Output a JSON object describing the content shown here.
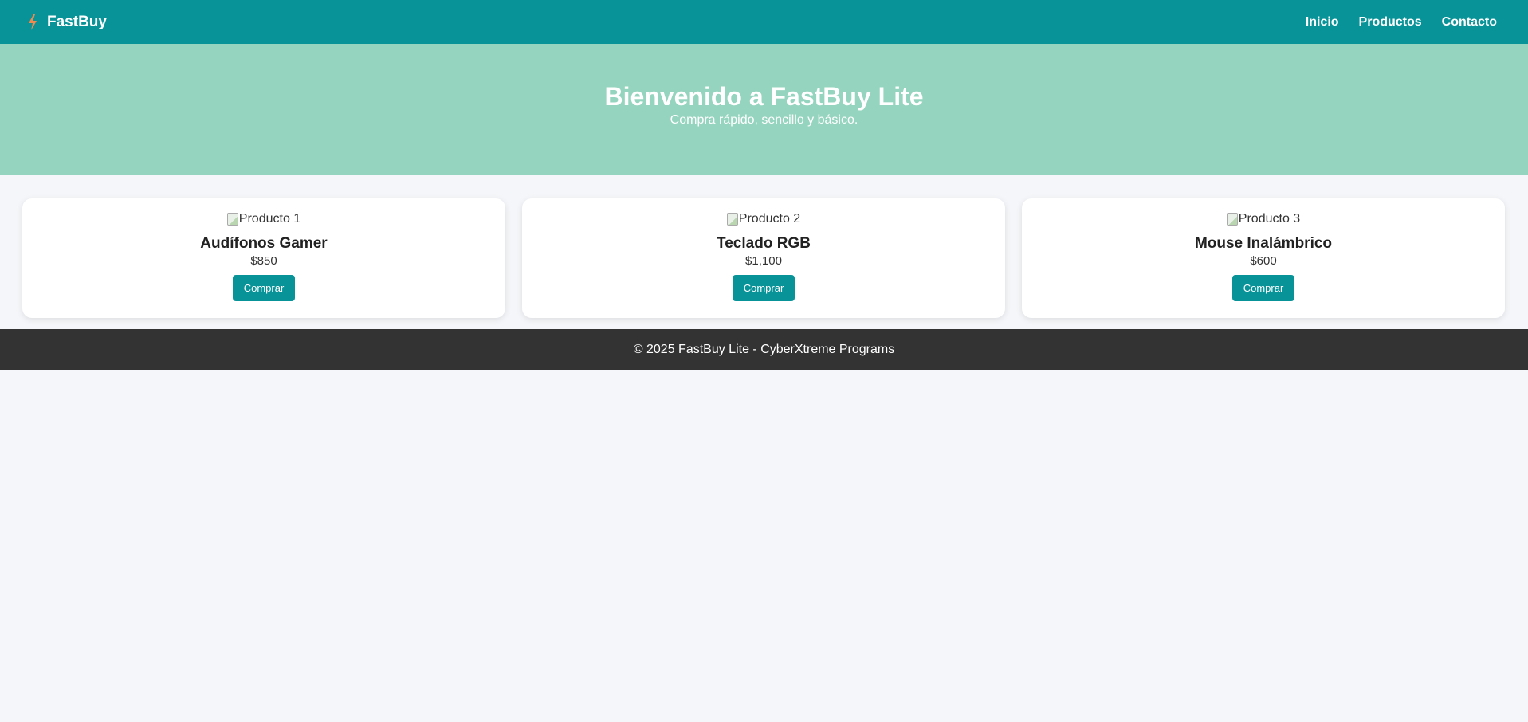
{
  "header": {
    "brand": "FastBuy",
    "brand_icon": "bolt-icon",
    "nav": [
      {
        "label": "Inicio"
      },
      {
        "label": "Productos"
      },
      {
        "label": "Contacto"
      }
    ]
  },
  "hero": {
    "title": "Bienvenido a FastBuy Lite",
    "subtitle": "Compra rápido, sencillo y básico."
  },
  "products": [
    {
      "image_alt": "Producto 1",
      "name": "Audífonos Gamer",
      "price": "$850",
      "button": "Comprar"
    },
    {
      "image_alt": "Producto 2",
      "name": "Teclado RGB",
      "price": "$1,100",
      "button": "Comprar"
    },
    {
      "image_alt": "Producto 3",
      "name": "Mouse Inalámbrico",
      "price": "$600",
      "button": "Comprar"
    }
  ],
  "footer": {
    "text": "© 2025 FastBuy Lite - CyberXtreme Programs"
  },
  "colors": {
    "primary": "#089398",
    "hero": "#95d4be",
    "background": "#f4f6f9",
    "footer": "#333333",
    "bolt": "#f2894e"
  }
}
